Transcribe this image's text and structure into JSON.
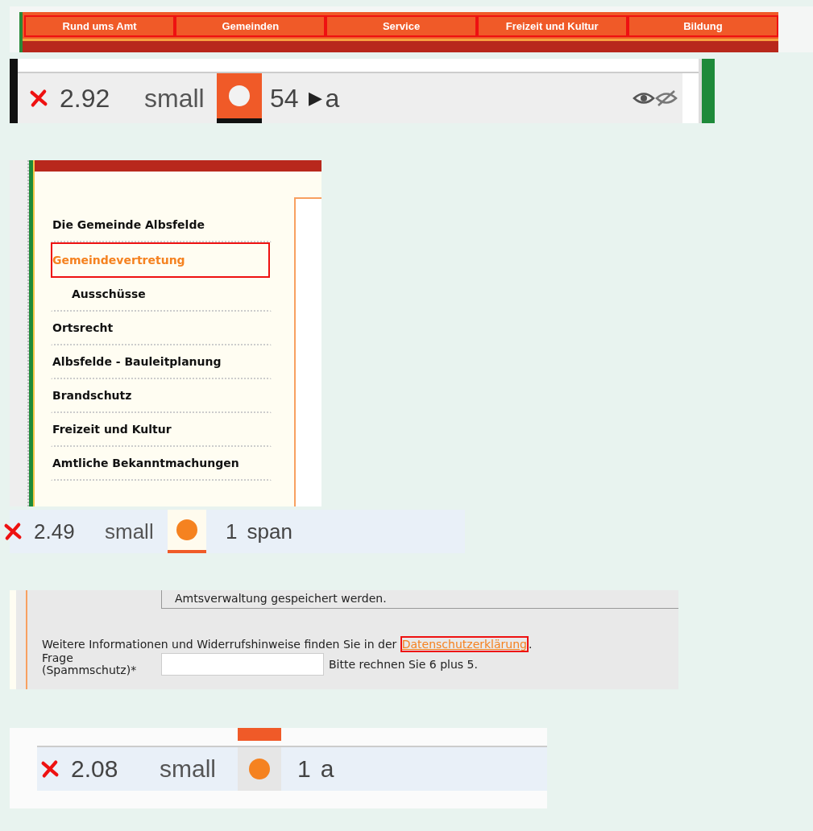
{
  "nav": {
    "tabs": [
      {
        "label": "Rund ums Amt"
      },
      {
        "label": "Gemeinden"
      },
      {
        "label": "Service"
      },
      {
        "label": "Freizeit und Kultur"
      },
      {
        "label": "Bildung"
      }
    ]
  },
  "results": [
    {
      "score": "2.92",
      "size": "small",
      "kind": "filled",
      "count": "54",
      "caret": "▶",
      "element": "a",
      "visibility_icons": true
    },
    {
      "score": "2.49",
      "size": "small",
      "kind": "underlined",
      "count": "1",
      "element": "span"
    },
    {
      "score": "2.08",
      "size": "small",
      "kind": "tabbed",
      "count": "1",
      "element": "a"
    }
  ],
  "sidebar": {
    "items": [
      {
        "label": "Die Gemeinde Albsfelde",
        "selected": false
      },
      {
        "label": "Gemeindevertretung",
        "selected": true,
        "children": [
          {
            "label": "Ausschüsse",
            "selected": false
          }
        ]
      },
      {
        "label": "Ortsrecht",
        "selected": false
      },
      {
        "label": "Albsfelde - Bauleitplanung",
        "selected": false
      },
      {
        "label": "Brandschutz",
        "selected": false
      },
      {
        "label": "Freizeit und Kultur",
        "selected": false
      },
      {
        "label": "Amtliche Bekanntmachungen",
        "selected": false
      }
    ]
  },
  "form": {
    "note": "Amtsverwaltung gespeichert werden.",
    "info": "Weitere Informationen und Widerrufshinweise finden Sie in der",
    "link": "Datenschutzerklärung",
    "info_end": ".",
    "question_label": "Frage (Spammschutz)*",
    "question_hint": "Bitte rechnen Sie 6 plus 5."
  }
}
